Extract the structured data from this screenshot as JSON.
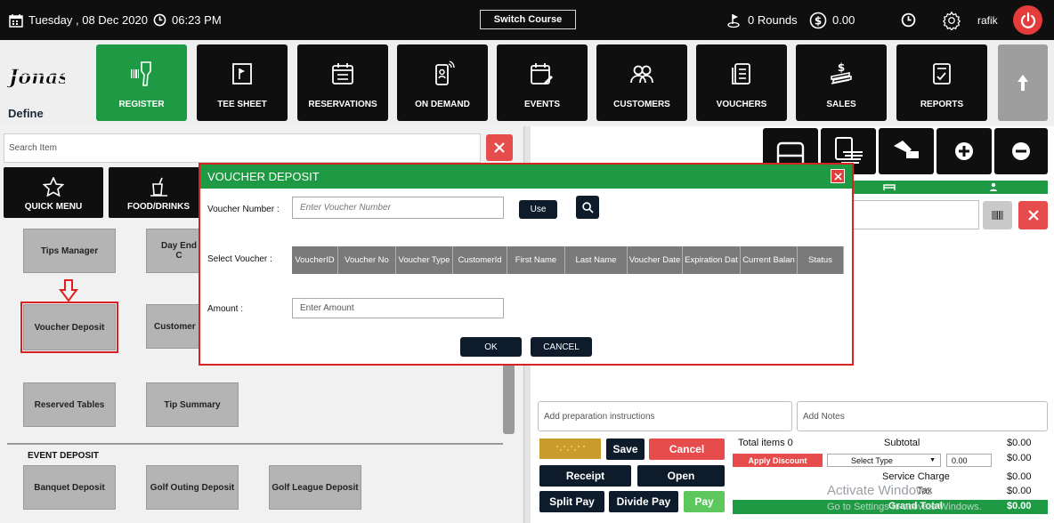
{
  "topbar": {
    "date": "Tuesday , 08 Dec 2020",
    "time": "06:23 PM",
    "switch_course": "Switch Course",
    "rounds": "0 Rounds",
    "balance": "0.00",
    "user": "rafik"
  },
  "nav": {
    "define": "Define",
    "items": [
      "REGISTER",
      "TEE SHEET",
      "RESERVATIONS",
      "ON DEMAND",
      "EVENTS",
      "CUSTOMERS",
      "VOUCHERS",
      "SALES",
      "REPORTS"
    ]
  },
  "left": {
    "search_placeholder": "Search Item",
    "categories": [
      "QUICK MENU",
      "FOOD/DRINKS"
    ],
    "tiles": [
      "Tips Manager",
      "Day End C",
      "Voucher Deposit",
      "Customer",
      "Reserved Tables",
      "Tip Summary"
    ],
    "event_deposit_label": "EVENT DEPOSIT",
    "event_tiles": [
      "Banquet Deposit",
      "Golf Outing Deposit",
      "Golf League Deposit"
    ]
  },
  "right": {
    "prep_placeholder": "Add preparation instructions",
    "notes_placeholder": "Add Notes",
    "save": "Save",
    "cancel": "Cancel",
    "receipt": "Receipt",
    "open": "Open",
    "split_pay": "Split Pay",
    "divide_pay": "Divide Pay",
    "pay": "Pay",
    "total_items_label": "Total items",
    "total_items_value": "0",
    "subtotal_label": "Subtotal",
    "subtotal_value": "$0.00",
    "apply_discount": "Apply Discount",
    "select_type": "Select Type",
    "discount_value": "0.00",
    "discount_amount": "$0.00",
    "service_charge_label": "Service Charge",
    "service_charge_value": "$0.00",
    "tax_label": "Tax",
    "tax_value": "$0.00",
    "grand_total_label": "Grand Total",
    "grand_total_value": "$0.00",
    "watermark_line1": "Activate Windows",
    "watermark_line2": "Go to Settings to activate Windows."
  },
  "modal": {
    "title": "VOUCHER DEPOSIT",
    "voucher_number_label": "Voucher Number :",
    "voucher_number_placeholder": "Enter Voucher Number",
    "use": "Use",
    "select_voucher_label": "Select Voucher :",
    "columns": [
      "VoucherID",
      "Voucher No",
      "Voucher Type",
      "CustomerId",
      "First Name",
      "Last Name",
      "Voucher Date",
      "Expiration Dat",
      "Current Balan",
      "Status"
    ],
    "amount_label": "Amount :",
    "amount_placeholder": "Enter Amount",
    "ok": "OK",
    "cancel": "CANCEL"
  }
}
